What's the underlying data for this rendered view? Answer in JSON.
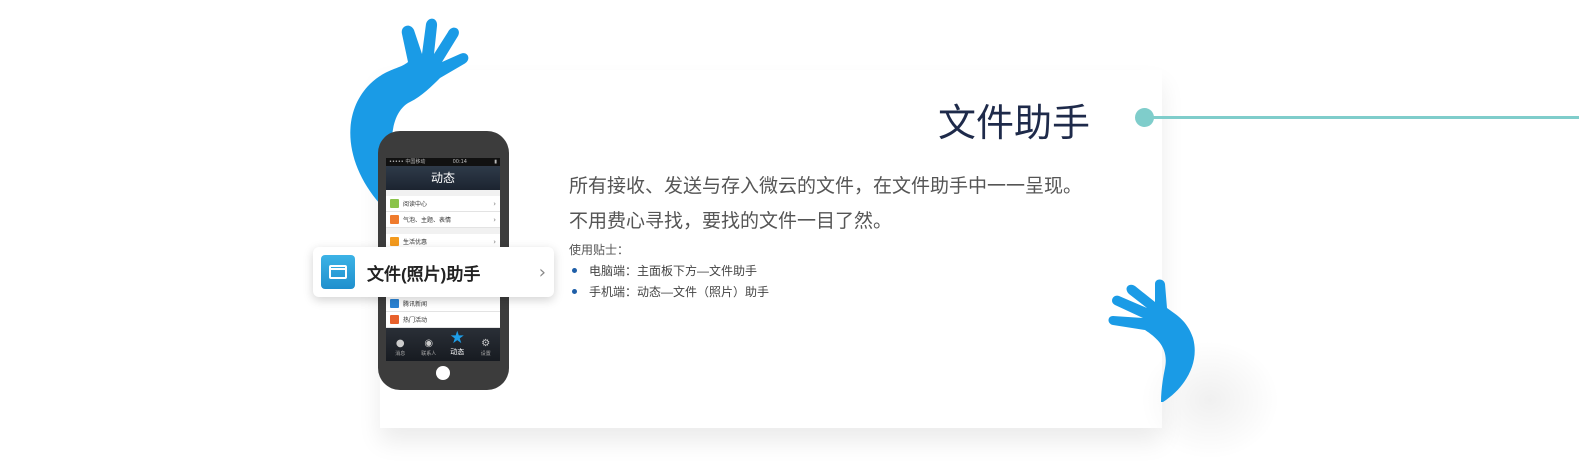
{
  "feature": {
    "title": "文件助手",
    "description_lines": [
      "所有接收、发送与存入微云的文件，在文件助手中一一呈现。",
      "不用费心寻找，要找的文件一目了然。"
    ],
    "tips_title": "使用贴士：",
    "tips": [
      "电脑端：主面板下方—文件助手",
      "手机端：动态—文件（照片）助手"
    ]
  },
  "phone": {
    "status_left": "••••• 中国移动",
    "status_time": "00:14",
    "screen_title": "动态",
    "rows": [
      {
        "label": "阅读中心",
        "icon_color": "#8bc34a"
      },
      {
        "label": "气泡、主题、表情",
        "icon_color": "#ef7b2d"
      },
      {
        "label": "生活优惠",
        "icon_color": "#f39a1e"
      },
      {
        "label": "腾讯新闻",
        "icon_color": "#2a83d4"
      },
      {
        "label": "热门活动",
        "icon_color": "#e8612c"
      }
    ],
    "tabs": [
      {
        "label": "消息",
        "icon": "bell-icon",
        "glyph": "●"
      },
      {
        "label": "联系人",
        "icon": "contacts-icon",
        "glyph": "◉"
      },
      {
        "label": "动态",
        "icon": "star-icon",
        "glyph": "★"
      },
      {
        "label": "设置",
        "icon": "gear-icon",
        "glyph": "⚙"
      }
    ]
  },
  "popup": {
    "label": "文件(照片)助手",
    "icon": "folder-icon"
  },
  "colors": {
    "hand_blue": "#1a9be6",
    "deco_teal": "#7fcdcb",
    "title_navy": "#1e2a4a"
  }
}
